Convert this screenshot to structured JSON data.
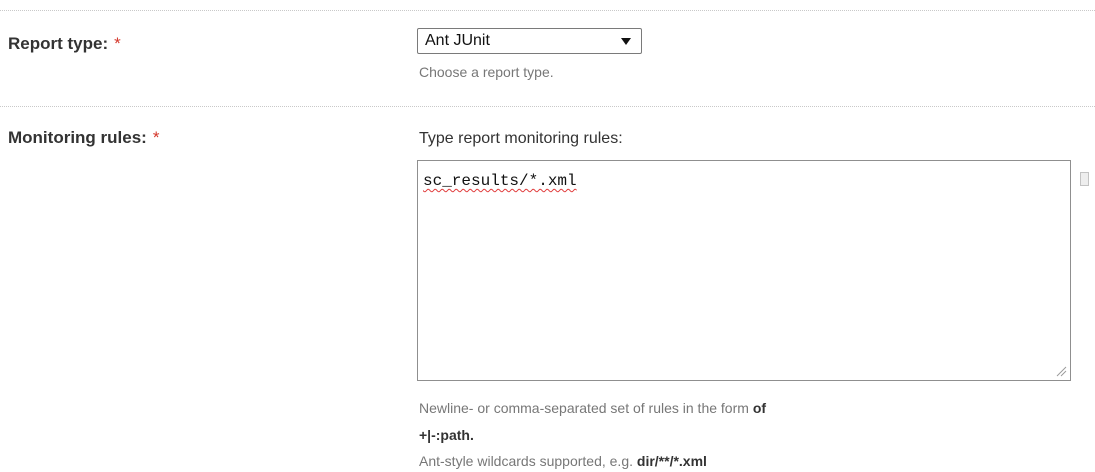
{
  "report_type": {
    "label": "Report type:",
    "required_marker": "*",
    "selected": "Ant JUnit",
    "hint": "Choose a report type."
  },
  "monitoring_rules": {
    "label": "Monitoring rules:",
    "required_marker": "*",
    "caption": "Type report monitoring rules:",
    "value": "sc_results/*.xml",
    "help_line1_prefix": "Newline- or comma-separated set of rules in the form ",
    "help_line1_bold": "of",
    "help_line2": "+|-:path.",
    "help_line3_prefix": "Ant-style wildcards supported, e.g. ",
    "help_line3_bold": "dir/**/*.xml"
  },
  "colors": {
    "required": "#d4362a",
    "spellcheck": "#e03a3a",
    "hint_text": "#777777"
  },
  "icons": {
    "select_arrow": "chevron-down-icon",
    "textarea_grip": "resize-grip-icon"
  }
}
